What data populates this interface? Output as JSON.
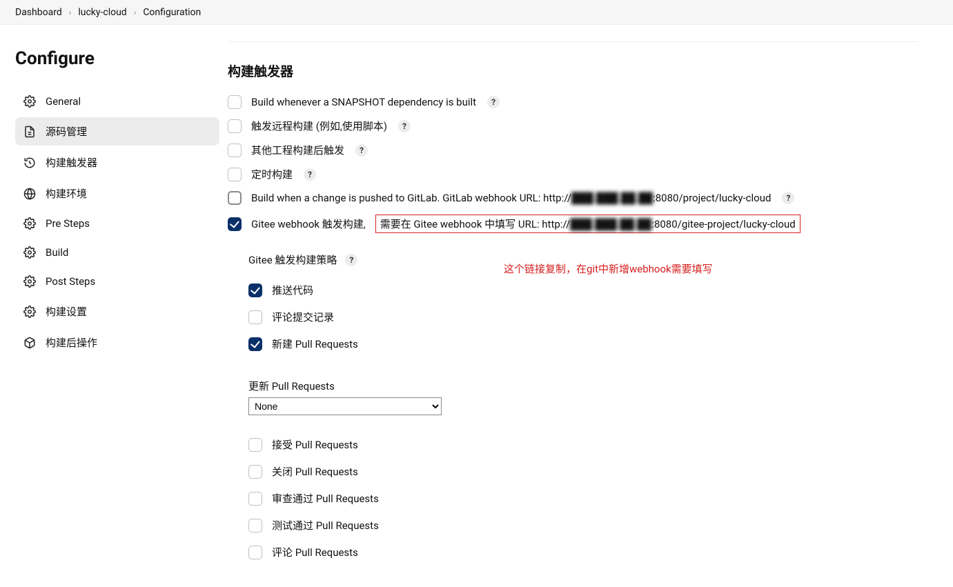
{
  "breadcrumb": {
    "items": [
      "Dashboard",
      "lucky-cloud",
      "Configuration"
    ]
  },
  "sidebar": {
    "title": "Configure",
    "items": [
      {
        "label": "General",
        "icon": "gear-icon"
      },
      {
        "label": "源码管理",
        "icon": "document-icon",
        "active": true
      },
      {
        "label": "构建触发器",
        "icon": "clock-icon"
      },
      {
        "label": "构建环境",
        "icon": "globe-icon"
      },
      {
        "label": "Pre Steps",
        "icon": "gear-icon"
      },
      {
        "label": "Build",
        "icon": "gear-icon"
      },
      {
        "label": "Post Steps",
        "icon": "gear-icon"
      },
      {
        "label": "构建设置",
        "icon": "gear-icon"
      },
      {
        "label": "构建后操作",
        "icon": "box-icon"
      }
    ]
  },
  "section": {
    "title": "构建触发器"
  },
  "triggers": {
    "snapshot": {
      "label": "Build whenever a SNAPSHOT dependency is built",
      "checked": false,
      "help": true
    },
    "remote": {
      "label": "触发远程构建 (例如,使用脚本)",
      "checked": false,
      "help": true
    },
    "after": {
      "label": "其他工程构建后触发",
      "checked": false,
      "help": true
    },
    "timer": {
      "label": "定时构建",
      "checked": false,
      "help": true
    },
    "gitlab": {
      "prefix": "Build when a change is pushed to GitLab. GitLab webhook URL: http://",
      "blurred_host": "███.███.██.██",
      "suffix": ":8080/project/lucky-cloud",
      "checked": false,
      "help": true
    },
    "gitee": {
      "prefix_label": "Gitee webhook 触发构建,",
      "hl_prefix": "需要在 Gitee webhook 中填写 URL: http://",
      "hl_blurred_host": "███.███.██.██",
      "hl_suffix": ":8080/gitee-project/lucky-cloud",
      "checked": true,
      "note": "这个链接复制，在git中新增webhook需要填写"
    }
  },
  "gitee_strategy": {
    "title": "Gitee 触发构建策略",
    "push_code": {
      "label": "推送代码",
      "checked": true
    },
    "comment": {
      "label": "评论提交记录",
      "checked": false
    },
    "new_pr": {
      "label": "新建 Pull Requests",
      "checked": true
    },
    "update_pr_label": "更新 Pull Requests",
    "update_pr_select": {
      "value": "None",
      "options": [
        "None"
      ]
    },
    "accept_pr": {
      "label": "接受 Pull Requests",
      "checked": false
    },
    "close_pr": {
      "label": "关闭 Pull Requests",
      "checked": false
    },
    "review_pr": {
      "label": "审查通过 Pull Requests",
      "checked": false
    },
    "test_pr": {
      "label": "测试通过 Pull Requests",
      "checked": false
    },
    "comment_pr": {
      "label": "评论 Pull Requests",
      "checked": false
    }
  }
}
